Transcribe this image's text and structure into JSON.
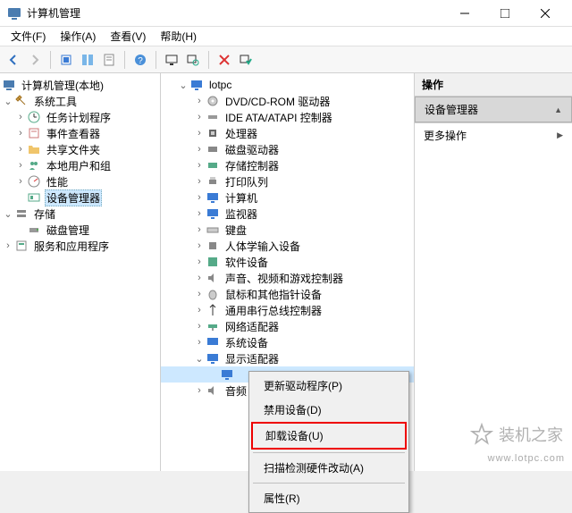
{
  "title": "计算机管理",
  "menu": {
    "file": "文件(F)",
    "action": "操作(A)",
    "view": "查看(V)",
    "help": "帮助(H)"
  },
  "left_tree": {
    "root": "计算机管理(本地)",
    "system_tools": "系统工具",
    "task_scheduler": "任务计划程序",
    "event_viewer": "事件查看器",
    "shared_folders": "共享文件夹",
    "local_users": "本地用户和组",
    "performance": "性能",
    "device_manager": "设备管理器",
    "storage": "存储",
    "disk_mgmt": "磁盘管理",
    "services_apps": "服务和应用程序"
  },
  "mid_tree": {
    "root": "lotpc",
    "dvd": "DVD/CD-ROM 驱动器",
    "ide": "IDE ATA/ATAPI 控制器",
    "cpu": "处理器",
    "disk": "磁盘驱动器",
    "storage_ctrl": "存储控制器",
    "print": "打印队列",
    "computer": "计算机",
    "monitor": "监视器",
    "keyboard": "键盘",
    "hid": "人体学输入设备",
    "software_dev": "软件设备",
    "audio_video": "声音、视频和游戏控制器",
    "mouse": "鼠标和其他指针设备",
    "usb": "通用串行总线控制器",
    "network": "网络适配器",
    "system_dev": "系统设备",
    "display": "显示适配器",
    "display_item": "",
    "audio_in_out": "音频"
  },
  "context_menu": {
    "update": "更新驱动程序(P)",
    "disable": "禁用设备(D)",
    "uninstall": "卸载设备(U)",
    "scan": "扫描检测硬件改动(A)",
    "properties": "属性(R)"
  },
  "actions": {
    "header": "操作",
    "device_manager": "设备管理器",
    "more_actions": "更多操作"
  },
  "watermark": {
    "text": "装机之家",
    "url": "www.lotpc.com"
  }
}
